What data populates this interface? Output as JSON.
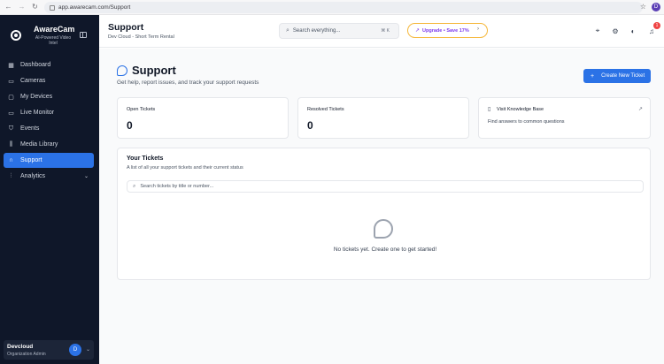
{
  "browser": {
    "url": "app.awarecam.com/Support",
    "profile_initial": "D"
  },
  "sidebar": {
    "brand_name": "AwareCam",
    "brand_sub": "AI-Powered Video Intel",
    "items": [
      {
        "label": "Dashboard",
        "icon": "grid-icon"
      },
      {
        "label": "Cameras",
        "icon": "camera-icon"
      },
      {
        "label": "My Devices",
        "icon": "device-icon"
      },
      {
        "label": "Live Monitor",
        "icon": "monitor-icon"
      },
      {
        "label": "Events",
        "icon": "shield-icon"
      },
      {
        "label": "Media Library",
        "icon": "library-icon"
      },
      {
        "label": "Support",
        "icon": "headset-icon"
      },
      {
        "label": "Analytics",
        "icon": "chart-icon"
      }
    ],
    "user": {
      "name": "Devcloud",
      "role": "Organization Admin",
      "initial": "D"
    }
  },
  "header": {
    "title": "Support",
    "subtitle": "Dev Cloud - Short Term Rental",
    "search_placeholder": "Search everything...",
    "search_shortcut": "⌘ K",
    "upgrade_label": "Upgrade • Save 17%",
    "notification_count": "1"
  },
  "main": {
    "title": "Support",
    "subtitle": "Get help, report issues, and track your support requests",
    "create_button": "Create New Ticket",
    "stats": {
      "open_label": "Open Tickets",
      "open_value": "0",
      "resolved_label": "Resolved Tickets",
      "resolved_value": "0"
    },
    "knowledge": {
      "label": "Visit Knowledge Base",
      "sub": "Find answers to common questions"
    },
    "tickets": {
      "title": "Your Tickets",
      "subtitle": "A list of all your support tickets and their current status",
      "search_placeholder": "Search tickets by title or number...",
      "empty_text": "No tickets yet. Create one to get started!"
    }
  }
}
